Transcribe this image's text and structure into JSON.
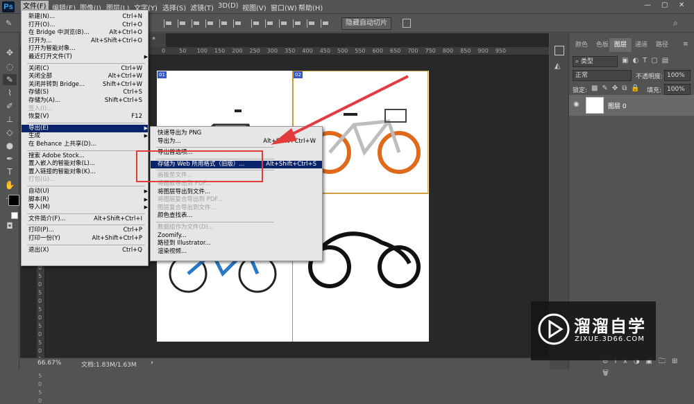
{
  "menubar": {
    "logo": "Ps",
    "items": [
      "文件(F)",
      "编辑(E)",
      "图像(I)",
      "图层(L)",
      "文字(Y)",
      "选择(S)",
      "滤镜(T)",
      "3D(D)",
      "视图(V)",
      "窗口(W)",
      "帮助(H)"
    ]
  },
  "window_controls": {
    "minimize": "—",
    "restore": "▢",
    "close": "✕"
  },
  "options": {
    "hide_auto_slices": "隐藏自动切片"
  },
  "document": {
    "tab_close": "×",
    "tab_suffix": "*",
    "zoom": "66.67%",
    "doc_info": "文档:1.83M/1.63M"
  },
  "ruler": {
    "h_ticks": [
      "0",
      "50",
      "100",
      "150",
      "200",
      "250",
      "300",
      "350",
      "400",
      "450",
      "500",
      "550",
      "600",
      "650",
      "700",
      "750",
      "800",
      "850",
      "900",
      "950"
    ],
    "v_ticks": [
      "5",
      "0",
      "5",
      "0",
      "5",
      "0",
      "5",
      "0",
      "5",
      "0",
      "5",
      "0",
      "5",
      "0",
      "5",
      "0",
      "5",
      "0"
    ]
  },
  "slices": [
    "01",
    "02"
  ],
  "file_menu": [
    {
      "label": "新建(N)...",
      "shortcut": "Ctrl+N"
    },
    {
      "label": "打开(O)...",
      "shortcut": "Ctrl+O"
    },
    {
      "label": "在 Bridge 中浏览(B)...",
      "shortcut": "Alt+Ctrl+O"
    },
    {
      "label": "打开为...",
      "shortcut": "Alt+Shift+Ctrl+O"
    },
    {
      "label": "打开为智能对象...",
      "shortcut": ""
    },
    {
      "label": "最近打开文件(T)",
      "shortcut": "",
      "arrow": true
    },
    {
      "sep": true
    },
    {
      "label": "关闭(C)",
      "shortcut": "Ctrl+W"
    },
    {
      "label": "关闭全部",
      "shortcut": "Alt+Ctrl+W"
    },
    {
      "label": "关闭并转到 Bridge...",
      "shortcut": "Shift+Ctrl+W"
    },
    {
      "label": "存储(S)",
      "shortcut": "Ctrl+S"
    },
    {
      "label": "存储为(A)...",
      "shortcut": "Shift+Ctrl+S"
    },
    {
      "label": "签入(I)...",
      "shortcut": "",
      "disabled": true
    },
    {
      "label": "恢复(V)",
      "shortcut": "F12"
    },
    {
      "sep": true
    },
    {
      "label": "导出(E)",
      "shortcut": "",
      "arrow": true,
      "highlight": true
    },
    {
      "label": "生成",
      "shortcut": "",
      "arrow": true
    },
    {
      "label": "在 Behance 上共享(D)...",
      "shortcut": ""
    },
    {
      "sep": true
    },
    {
      "label": "搜索 Adobe Stock...",
      "shortcut": ""
    },
    {
      "label": "置入嵌入的智能对象(L)...",
      "shortcut": ""
    },
    {
      "label": "置入链接的智能对象(K)...",
      "shortcut": ""
    },
    {
      "label": "打包(G)...",
      "shortcut": "",
      "disabled": true
    },
    {
      "sep": true
    },
    {
      "label": "自动(U)",
      "shortcut": "",
      "arrow": true
    },
    {
      "label": "脚本(R)",
      "shortcut": "",
      "arrow": true
    },
    {
      "label": "导入(M)",
      "shortcut": "",
      "arrow": true
    },
    {
      "sep": true
    },
    {
      "label": "文件简介(F)...",
      "shortcut": "Alt+Shift+Ctrl+I"
    },
    {
      "sep": true
    },
    {
      "label": "打印(P)...",
      "shortcut": "Ctrl+P"
    },
    {
      "label": "打印一份(Y)",
      "shortcut": "Alt+Shift+Ctrl+P"
    },
    {
      "sep": true
    },
    {
      "label": "退出(X)",
      "shortcut": "Ctrl+Q"
    }
  ],
  "export_menu": [
    {
      "label": "快速导出为 PNG",
      "shortcut": ""
    },
    {
      "label": "导出为...",
      "shortcut": "Alt+Shift+Ctrl+W"
    },
    {
      "sep": true
    },
    {
      "label": "导出首选项...",
      "shortcut": ""
    },
    {
      "sep": true
    },
    {
      "label": "存储为 Web 所用格式（旧版）...",
      "shortcut": "Alt+Shift+Ctrl+S",
      "highlight": true
    },
    {
      "sep": true
    },
    {
      "label": "画板至文件...",
      "shortcut": "",
      "disabled": true
    },
    {
      "label": "将画板导出到 PDF...",
      "shortcut": "",
      "disabled": true
    },
    {
      "label": "将图层导出到文件...",
      "shortcut": ""
    },
    {
      "label": "将图层复合导出到 PDF...",
      "shortcut": "",
      "disabled": true
    },
    {
      "label": "图层复合导出到文件...",
      "shortcut": "",
      "disabled": true
    },
    {
      "label": "颜色查找表...",
      "shortcut": ""
    },
    {
      "sep": true
    },
    {
      "label": "数据组作为文件(D)...",
      "shortcut": "",
      "disabled": true
    },
    {
      "label": "Zoomify...",
      "shortcut": ""
    },
    {
      "label": "路径到 Illustrator...",
      "shortcut": ""
    },
    {
      "label": "渲染视频...",
      "shortcut": ""
    }
  ],
  "panels": {
    "tabs": [
      "颜色",
      "色板",
      "图层",
      "通道",
      "路径"
    ],
    "active_tab": "图层",
    "kind_filter": "类型",
    "blend_mode": "正常",
    "opacity_label": "不透明度:",
    "opacity_value": "100%",
    "lock_label": "锁定:",
    "fill_label": "填充:",
    "fill_value": "100%",
    "layer_name": "图层 0"
  },
  "watermark": {
    "title": "溜溜自学",
    "subtitle": "ZIXUE.3D66.COM"
  },
  "colors": {
    "accent": "#0a246a",
    "red_annotation": "#e23b3b",
    "slice_badge": "#2f57d6"
  }
}
